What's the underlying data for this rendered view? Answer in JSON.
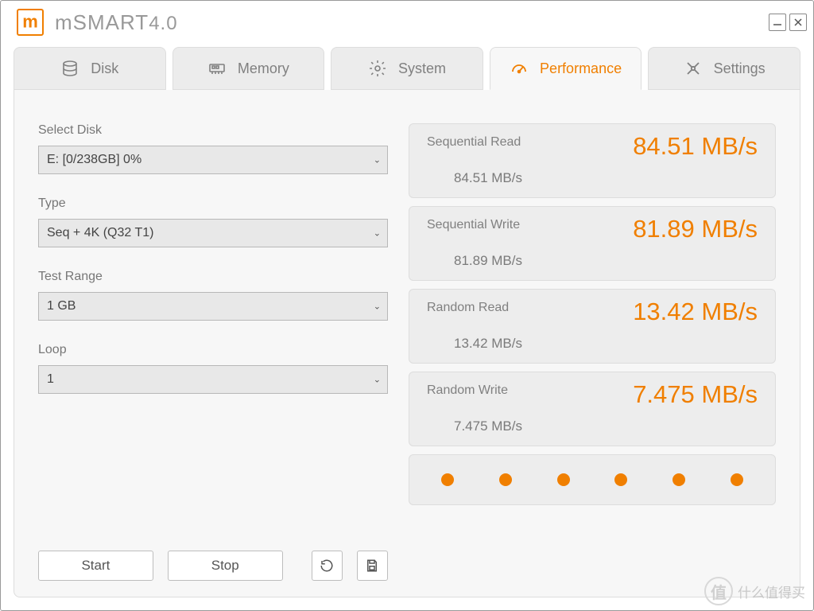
{
  "app": {
    "title_main": "mSMART",
    "title_ver": "4.0"
  },
  "tabs": {
    "disk": "Disk",
    "memory": "Memory",
    "system": "System",
    "performance": "Performance",
    "settings": "Settings",
    "active": "performance"
  },
  "form": {
    "select_disk": {
      "label": "Select Disk",
      "value": "E: [0/238GB] 0%"
    },
    "type": {
      "label": "Type",
      "value": "Seq + 4K (Q32 T1)"
    },
    "test_range": {
      "label": "Test Range",
      "value": "1 GB"
    },
    "loop": {
      "label": "Loop",
      "value": "1"
    }
  },
  "buttons": {
    "start": "Start",
    "stop": "Stop"
  },
  "results": {
    "seq_read": {
      "label": "Sequential Read",
      "big": "84.51 MB/s",
      "small": "84.51 MB/s"
    },
    "seq_write": {
      "label": "Sequential Write",
      "big": "81.89 MB/s",
      "small": "81.89 MB/s"
    },
    "rnd_read": {
      "label": "Random Read",
      "big": "13.42 MB/s",
      "small": "13.42 MB/s"
    },
    "rnd_write": {
      "label": "Random Write",
      "big": "7.475 MB/s",
      "small": "7.475 MB/s"
    }
  },
  "watermark": "什么值得买"
}
